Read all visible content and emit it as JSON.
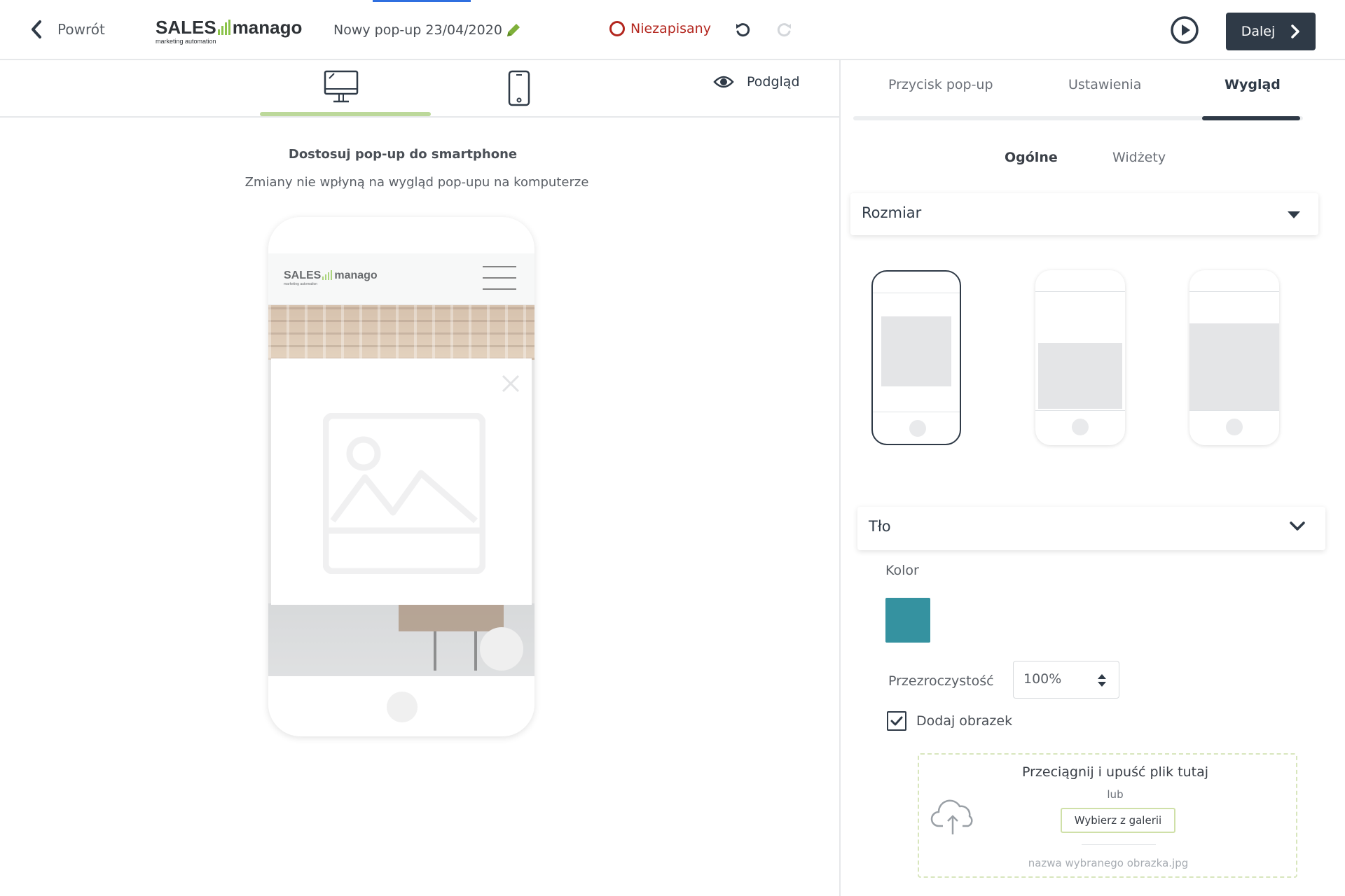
{
  "header": {
    "back_label": "Powrót",
    "logo_main_left": "SALES",
    "logo_main_right": "manago",
    "logo_sub": "marketing automation",
    "document_title": "Nowy pop-up 23/04/2020",
    "status_label": "Niezapisany",
    "next_label": "Dalej"
  },
  "editor": {
    "preview_label": "Podgląd",
    "hint_title": "Dostosuj pop-up do smartphone",
    "hint_subtitle": "Zmiany nie wpłyną na wygląd pop-upu na komputerze",
    "site_logo_left": "SALES",
    "site_logo_right": "manago",
    "site_logo_sub": "marketing automation"
  },
  "panel": {
    "tabs": [
      {
        "label": "Przycisk pop-up"
      },
      {
        "label": "Ustawienia"
      },
      {
        "label": "Wygląd"
      }
    ],
    "subtabs": [
      {
        "label": "Ogólne"
      },
      {
        "label": "Widżety"
      }
    ],
    "size_section_label": "Rozmiar",
    "background_section_label": "Tło",
    "color_label": "Kolor",
    "color_value": "#3592a0",
    "opacity_label": "Przezroczystość",
    "opacity_value": "100%",
    "add_image_label": "Dodaj obrazek",
    "add_image_checked": true,
    "drop_title": "Przeciągnij i upuść plik tutaj",
    "drop_or": "lub",
    "gallery_button": "Wybierz z galerii",
    "selected_file": "nazwa wybranego obrazka.jpg"
  },
  "colors": {
    "primary_dark": "#2f3a47",
    "accent_green": "#8bc34a",
    "status_red": "#b3261e"
  }
}
